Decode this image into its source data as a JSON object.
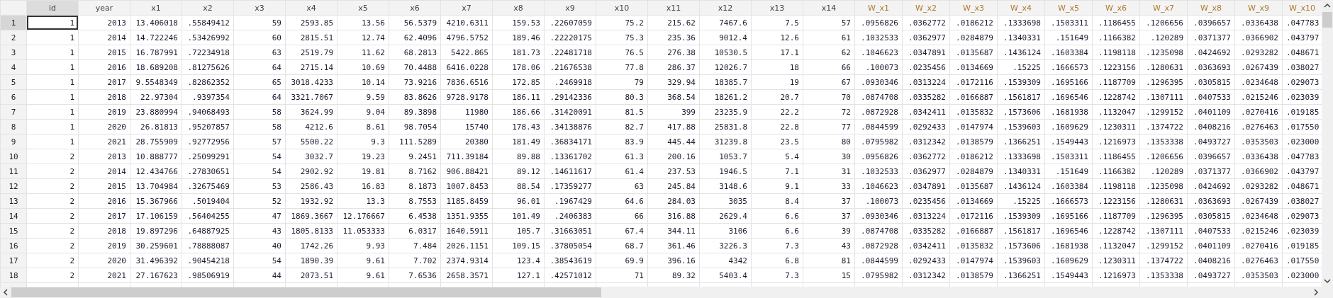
{
  "columns": [
    {
      "label": "id",
      "selected": true,
      "color": "#444444"
    },
    {
      "label": "year",
      "selected": false,
      "color": "#444444"
    },
    {
      "label": "x1",
      "selected": false,
      "color": "#444444"
    },
    {
      "label": "x2",
      "selected": false,
      "color": "#444444"
    },
    {
      "label": "x3",
      "selected": false,
      "color": "#444444"
    },
    {
      "label": "x4",
      "selected": false,
      "color": "#444444"
    },
    {
      "label": "x5",
      "selected": false,
      "color": "#444444"
    },
    {
      "label": "x6",
      "selected": false,
      "color": "#444444"
    },
    {
      "label": "x7",
      "selected": false,
      "color": "#444444"
    },
    {
      "label": "x8",
      "selected": false,
      "color": "#444444"
    },
    {
      "label": "x9",
      "selected": false,
      "color": "#444444"
    },
    {
      "label": "x10",
      "selected": false,
      "color": "#444444"
    },
    {
      "label": "x11",
      "selected": false,
      "color": "#444444"
    },
    {
      "label": "x12",
      "selected": false,
      "color": "#444444"
    },
    {
      "label": "x13",
      "selected": false,
      "color": "#444444"
    },
    {
      "label": "x14",
      "selected": false,
      "color": "#444444"
    },
    {
      "label": "W_x1",
      "selected": false,
      "color": "#b0782e"
    },
    {
      "label": "W_x2",
      "selected": false,
      "color": "#b0782e"
    },
    {
      "label": "W_x3",
      "selected": false,
      "color": "#b0782e"
    },
    {
      "label": "W_x4",
      "selected": false,
      "color": "#b0782e"
    },
    {
      "label": "W_x5",
      "selected": false,
      "color": "#b0782e"
    },
    {
      "label": "W_x6",
      "selected": false,
      "color": "#b0782e"
    },
    {
      "label": "W_x7",
      "selected": false,
      "color": "#b0782e"
    },
    {
      "label": "W_x8",
      "selected": false,
      "color": "#b0782e"
    },
    {
      "label": "W_x9",
      "selected": false,
      "color": "#b0782e"
    },
    {
      "label": "W_x10",
      "selected": false,
      "color": "#b0782e"
    }
  ],
  "rows": [
    {
      "label": "1",
      "selected": true,
      "cells": [
        "1",
        "2013",
        "13.406018",
        ".55849412",
        "59",
        "2593.85",
        "13.56",
        "56.5379",
        "4210.6311",
        "159.53",
        ".22607059",
        "75.2",
        "215.62",
        "7467.6",
        "7.5",
        "57",
        ".0956826",
        ".0362772",
        ".0186212",
        ".1333698",
        ".1503311",
        ".1186455",
        ".1206656",
        ".0396657",
        ".0336438",
        ".047783"
      ]
    },
    {
      "label": "2",
      "selected": false,
      "cells": [
        "1",
        "2014",
        "14.722246",
        ".53426992",
        "60",
        "2815.51",
        "12.74",
        "62.4096",
        "4796.5752",
        "189.46",
        ".22220175",
        "75.3",
        "235.36",
        "9012.4",
        "12.6",
        "61",
        ".1032533",
        ".0362977",
        ".0284879",
        ".1340331",
        ".151649",
        ".1166382",
        ".120289",
        ".0371377",
        ".0366902",
        ".043797"
      ]
    },
    {
      "label": "3",
      "selected": false,
      "cells": [
        "1",
        "2015",
        "16.787991",
        ".72234918",
        "63",
        "2519.79",
        "11.62",
        "68.2813",
        "5422.865",
        "181.73",
        ".22481718",
        "76.5",
        "276.38",
        "10530.5",
        "17.1",
        "62",
        ".1046623",
        ".0347891",
        ".0135687",
        ".1436124",
        ".1603384",
        ".1198118",
        ".1235098",
        ".0424692",
        ".0293282",
        ".048671"
      ]
    },
    {
      "label": "4",
      "selected": false,
      "cells": [
        "1",
        "2016",
        "18.689208",
        ".81275626",
        "64",
        "2715.14",
        "10.69",
        "70.4488",
        "6416.0228",
        "178.06",
        ".21676538",
        "77.8",
        "286.37",
        "12026.7",
        "18",
        "66",
        ".100073",
        ".0235456",
        ".0134669",
        ".15225",
        ".1666573",
        ".1223156",
        ".1280631",
        ".0363693",
        ".0267439",
        ".038027"
      ]
    },
    {
      "label": "5",
      "selected": false,
      "cells": [
        "1",
        "2017",
        "9.5548349",
        ".82862352",
        "65",
        "3018.4233",
        "10.14",
        "73.9216",
        "7836.6516",
        "172.85",
        ".2469918",
        "79",
        "329.94",
        "18385.7",
        "19",
        "67",
        ".0930346",
        ".0313224",
        ".0172116",
        ".1539309",
        ".1695166",
        ".1187709",
        ".1296395",
        ".0305815",
        ".0234648",
        ".029073"
      ]
    },
    {
      "label": "6",
      "selected": false,
      "cells": [
        "1",
        "2018",
        "22.97304",
        ".9397354",
        "64",
        "3321.7067",
        "9.59",
        "83.8626",
        "9728.9178",
        "186.11",
        ".29142336",
        "80.3",
        "368.54",
        "18261.2",
        "20.7",
        "70",
        ".0874708",
        ".0335282",
        ".0166887",
        ".1561817",
        ".1696546",
        ".1228742",
        ".1307111",
        ".0407533",
        ".0215246",
        ".023039"
      ]
    },
    {
      "label": "7",
      "selected": false,
      "cells": [
        "1",
        "2019",
        "23.880994",
        ".94068493",
        "58",
        "3624.99",
        "9.04",
        "89.3898",
        "11980",
        "186.66",
        ".31420091",
        "81.5",
        "399",
        "23235.9",
        "22.2",
        "72",
        ".0872928",
        ".0342411",
        ".0135832",
        ".1573606",
        ".1681938",
        ".1132047",
        ".1299152",
        ".0401109",
        ".0270416",
        ".019185"
      ]
    },
    {
      "label": "8",
      "selected": false,
      "cells": [
        "1",
        "2020",
        "26.81813",
        ".95207857",
        "58",
        "4212.6",
        "8.61",
        "98.7054",
        "15740",
        "178.43",
        ".34138876",
        "82.7",
        "417.88",
        "25831.8",
        "22.8",
        "77",
        ".0844599",
        ".0292433",
        ".0147974",
        ".1539603",
        ".1609629",
        ".1230311",
        ".1374722",
        ".0408216",
        ".0276463",
        ".017550"
      ]
    },
    {
      "label": "9",
      "selected": false,
      "cells": [
        "1",
        "2021",
        "28.755909",
        ".92772956",
        "57",
        "5500.22",
        "9.3",
        "111.5289",
        "20380",
        "181.49",
        ".36834171",
        "83.9",
        "445.44",
        "31239.8",
        "23.5",
        "80",
        ".0795982",
        ".0312342",
        ".0138579",
        ".1366251",
        ".1549443",
        ".1216973",
        ".1353338",
        ".0493727",
        ".0353503",
        ".023000"
      ]
    },
    {
      "label": "10",
      "selected": false,
      "cells": [
        "2",
        "2013",
        "10.888777",
        ".25099291",
        "54",
        "3032.7",
        "19.23",
        "9.2451",
        "711.39184",
        "89.88",
        ".13361702",
        "61.3",
        "200.16",
        "1053.7",
        "5.4",
        "30",
        ".0956826",
        ".0362772",
        ".0186212",
        ".1333698",
        ".1503311",
        ".1186455",
        ".1206656",
        ".0396657",
        ".0336438",
        ".047783"
      ]
    },
    {
      "label": "11",
      "selected": false,
      "cells": [
        "2",
        "2014",
        "12.434766",
        ".27830651",
        "54",
        "2902.92",
        "19.81",
        "8.7162",
        "906.88421",
        "89.12",
        ".14611617",
        "61.4",
        "237.53",
        "1946.5",
        "7.1",
        "31",
        ".1032533",
        ".0362977",
        ".0284879",
        ".1340331",
        ".151649",
        ".1166382",
        ".120289",
        ".0371377",
        ".0366902",
        ".043797"
      ]
    },
    {
      "label": "12",
      "selected": false,
      "cells": [
        "2",
        "2015",
        "13.704984",
        ".32675469",
        "53",
        "2586.43",
        "16.83",
        "8.1873",
        "1007.8453",
        "88.54",
        ".17359277",
        "63",
        "245.84",
        "3148.6",
        "9.1",
        "33",
        ".1046623",
        ".0347891",
        ".0135687",
        ".1436124",
        ".1603384",
        ".1198118",
        ".1235098",
        ".0424692",
        ".0293282",
        ".048671"
      ]
    },
    {
      "label": "13",
      "selected": false,
      "cells": [
        "2",
        "2016",
        "15.367966",
        ".5019404",
        "52",
        "1932.92",
        "13.3",
        "8.7553",
        "1185.8459",
        "96.01",
        ".1967429",
        "64.6",
        "284.03",
        "3035",
        "8.4",
        "37",
        ".100073",
        ".0235456",
        ".0134669",
        ".15225",
        ".1666573",
        ".1223156",
        ".1280631",
        ".0363693",
        ".0267439",
        ".038027"
      ]
    },
    {
      "label": "14",
      "selected": false,
      "cells": [
        "2",
        "2017",
        "17.106159",
        ".56404255",
        "47",
        "1869.3667",
        "12.176667",
        "6.4538",
        "1351.9355",
        "101.49",
        ".2406383",
        "66",
        "316.88",
        "2629.4",
        "6.6",
        "37",
        ".0930346",
        ".0313224",
        ".0172116",
        ".1539309",
        ".1695166",
        ".1187709",
        ".1296395",
        ".0305815",
        ".0234648",
        ".029073"
      ]
    },
    {
      "label": "15",
      "selected": false,
      "cells": [
        "2",
        "2018",
        "19.897296",
        ".64887925",
        "43",
        "1805.8133",
        "11.053333",
        "6.0317",
        "1640.5911",
        "105.7",
        ".31663051",
        "67.4",
        "344.11",
        "3106",
        "6.6",
        "39",
        ".0874708",
        ".0335282",
        ".0166887",
        ".1561817",
        ".1696546",
        ".1228742",
        ".1307111",
        ".0407533",
        ".0215246",
        ".023039"
      ]
    },
    {
      "label": "16",
      "selected": false,
      "cells": [
        "2",
        "2019",
        "30.259601",
        ".78888087",
        "40",
        "1742.26",
        "9.93",
        "7.484",
        "2026.1151",
        "109.15",
        ".37805054",
        "68.7",
        "361.46",
        "3226.3",
        "7.3",
        "43",
        ".0872928",
        ".0342411",
        ".0135832",
        ".1573606",
        ".1681938",
        ".1132047",
        ".1299152",
        ".0401109",
        ".0270416",
        ".019185"
      ]
    },
    {
      "label": "17",
      "selected": false,
      "cells": [
        "2",
        "2020",
        "31.496392",
        ".90454218",
        "54",
        "1890.39",
        "9.61",
        "7.702",
        "2374.9314",
        "123.4",
        ".38543619",
        "69.9",
        "396.16",
        "4342",
        "6.8",
        "81",
        ".0844599",
        ".0292433",
        ".0147974",
        ".1539603",
        ".1609629",
        ".1230311",
        ".1374722",
        ".0408216",
        ".0276463",
        ".017550"
      ]
    },
    {
      "label": "18",
      "selected": false,
      "cells": [
        "2",
        "2021",
        "27.167623",
        ".98506919",
        "44",
        "2073.51",
        "9.61",
        "7.6536",
        "2658.3571",
        "127.1",
        ".42571012",
        "71",
        "89.32",
        "5403.4",
        "7.3",
        "15",
        ".0795982",
        ".0312342",
        ".0138579",
        ".1366251",
        ".1549443",
        ".1216973",
        ".1353338",
        ".0493727",
        ".0353503",
        ".023000"
      ]
    }
  ]
}
